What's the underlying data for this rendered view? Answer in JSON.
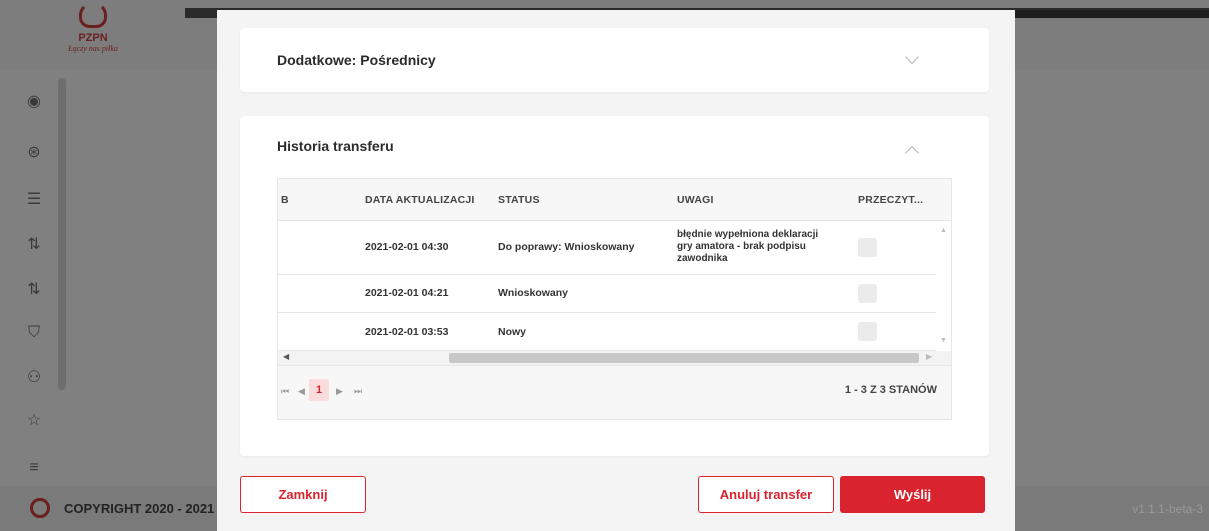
{
  "background": {
    "logo_name": "PZPN",
    "logo_tagline": "Łączy nas piłka",
    "footer_copyright": "COPYRIGHT 2020 - 2021",
    "footer_version": "v1.1.1-beta-3",
    "sidebar_icons": [
      "user-circle-icon",
      "ball-icon",
      "archive-icon",
      "transfer-icon",
      "transfer-icon",
      "shirt-icon",
      "people-icon",
      "star-icon",
      "menu-icon"
    ]
  },
  "modal": {
    "panel_intermediaries": {
      "title": "Dodatkowe: Pośrednicy"
    },
    "panel_history": {
      "title": "Historia transferu",
      "columns": [
        "B",
        "DATA AKTUALIZACJI",
        "STATUS",
        "UWAGI",
        "PRZECZYT..."
      ],
      "rows": [
        {
          "date": "2021-02-01 04:30",
          "status": "Do poprawy: Wnioskowany",
          "notes": "błędnie wypełniona deklaracji gry amatora - brak podpisu zawodnika"
        },
        {
          "date": "2021-02-01 04:21",
          "status": "Wnioskowany",
          "notes": ""
        },
        {
          "date": "2021-02-01 03:53",
          "status": "Nowy",
          "notes": ""
        }
      ],
      "pager": {
        "current_page": "1",
        "info": "1 - 3 Z 3 STANÓW"
      }
    },
    "buttons": {
      "close": "Zamknij",
      "cancel_transfer": "Anuluj transfer",
      "send": "Wyślij"
    }
  },
  "colors": {
    "accent": "#d9232e",
    "page_highlight": "#fbdcdc"
  }
}
